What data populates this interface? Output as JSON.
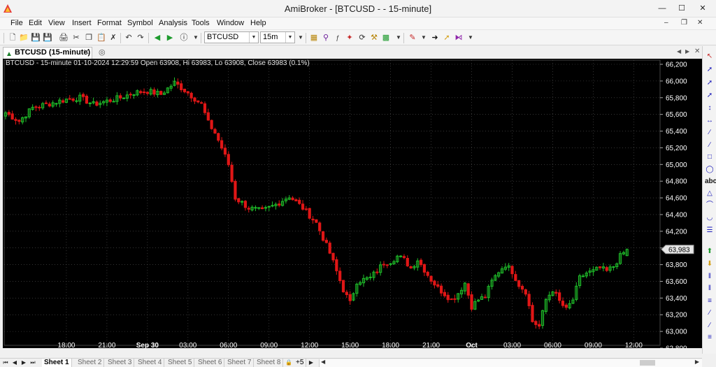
{
  "window": {
    "title": "AmiBroker - [BTCUSD -  - 15-minute]"
  },
  "menu": [
    "File",
    "Edit",
    "View",
    "Insert",
    "Format",
    "Symbol",
    "Analysis",
    "Tools",
    "Window",
    "Help"
  ],
  "toolbar": {
    "symbol": "BTCUSD",
    "interval": "15m"
  },
  "tab": {
    "label": "BTCUSD (15-minute)"
  },
  "chart": {
    "header": "BTCUSD - 15-minute 01-10-2024 12:29:59 Open 63908, Hi 63983, Lo 63908, Close 63983 (0.1%)",
    "last_price_label": "63,983"
  },
  "sheets": [
    "Sheet 1",
    "Sheet 2",
    "Sheet 3",
    "Sheet 4",
    "Sheet 5",
    "Sheet 6",
    "Sheet 7",
    "Sheet 8"
  ],
  "sheet_extra": "+5",
  "colors": {
    "background": "#000000",
    "up": "#1fbf2a",
    "down": "#e01616",
    "grid": "#555555",
    "axis_text": "#ffffff"
  },
  "chart_data": {
    "type": "candlestick",
    "symbol": "BTCUSD",
    "interval": "15-minute",
    "ylim": [
      62800,
      66200
    ],
    "y_ticks": [
      62800,
      63000,
      63200,
      63400,
      63600,
      63800,
      64000,
      64200,
      64400,
      64600,
      64800,
      65000,
      65200,
      65400,
      65600,
      65800,
      66000,
      66200
    ],
    "y_tick_labels": [
      "62,800",
      "63,000",
      "63,200",
      "63,400",
      "63,600",
      "63,800",
      "64,000",
      "64,200",
      "64,400",
      "64,600",
      "64,800",
      "65,000",
      "65,200",
      "65,400",
      "65,600",
      "65,800",
      "66,000",
      "66,200"
    ],
    "x_ticks": [
      {
        "label": "18:00",
        "bar": 18
      },
      {
        "label": "21:00",
        "bar": 30
      },
      {
        "label": "Sep 30",
        "bar": 42
      },
      {
        "label": "03:00",
        "bar": 54
      },
      {
        "label": "06:00",
        "bar": 66
      },
      {
        "label": "09:00",
        "bar": 78
      },
      {
        "label": "12:00",
        "bar": 90
      },
      {
        "label": "15:00",
        "bar": 102
      },
      {
        "label": "18:00",
        "bar": 114
      },
      {
        "label": "21:00",
        "bar": 126
      },
      {
        "label": "Oct",
        "bar": 138
      },
      {
        "label": "03:00",
        "bar": 150
      },
      {
        "label": "06:00",
        "bar": 162
      },
      {
        "label": "09:00",
        "bar": 174
      },
      {
        "label": "12:00",
        "bar": 186
      }
    ],
    "bar_count": 185,
    "close_path": [
      [
        0,
        65620
      ],
      [
        4,
        65520
      ],
      [
        8,
        65680
      ],
      [
        12,
        65720
      ],
      [
        18,
        65780
      ],
      [
        22,
        65800
      ],
      [
        26,
        65720
      ],
      [
        30,
        65760
      ],
      [
        34,
        65800
      ],
      [
        38,
        65860
      ],
      [
        42,
        65880
      ],
      [
        46,
        65840
      ],
      [
        50,
        65980
      ],
      [
        54,
        65860
      ],
      [
        58,
        65720
      ],
      [
        60,
        65500
      ],
      [
        62,
        65380
      ],
      [
        64,
        65200
      ],
      [
        66,
        65000
      ],
      [
        68,
        64600
      ],
      [
        72,
        64480
      ],
      [
        76,
        64440
      ],
      [
        80,
        64520
      ],
      [
        84,
        64620
      ],
      [
        88,
        64480
      ],
      [
        92,
        64300
      ],
      [
        96,
        63940
      ],
      [
        100,
        63500
      ],
      [
        102,
        63340
      ],
      [
        104,
        63600
      ],
      [
        108,
        63640
      ],
      [
        112,
        63820
      ],
      [
        114,
        63840
      ],
      [
        116,
        63900
      ],
      [
        118,
        63860
      ],
      [
        120,
        63760
      ],
      [
        122,
        63860
      ],
      [
        124,
        63740
      ],
      [
        126,
        63620
      ],
      [
        128,
        63520
      ],
      [
        132,
        63380
      ],
      [
        134,
        63460
      ],
      [
        136,
        63580
      ],
      [
        138,
        63300
      ],
      [
        140,
        63380
      ],
      [
        142,
        63420
      ],
      [
        144,
        63600
      ],
      [
        146,
        63720
      ],
      [
        148,
        63800
      ],
      [
        150,
        63720
      ],
      [
        152,
        63560
      ],
      [
        154,
        63480
      ],
      [
        156,
        63120
      ],
      [
        158,
        63060
      ],
      [
        160,
        63380
      ],
      [
        162,
        63500
      ],
      [
        164,
        63360
      ],
      [
        166,
        63260
      ],
      [
        168,
        63380
      ],
      [
        170,
        63640
      ],
      [
        172,
        63700
      ],
      [
        174,
        63720
      ],
      [
        176,
        63760
      ],
      [
        178,
        63720
      ],
      [
        180,
        63780
      ],
      [
        182,
        63900
      ],
      [
        184,
        63983
      ]
    ],
    "last_bar": {
      "date": "01-10-2024",
      "time": "12:29:59",
      "open": 63908,
      "high": 63983,
      "low": 63908,
      "close": 63983,
      "change_pct": 0.1
    }
  }
}
